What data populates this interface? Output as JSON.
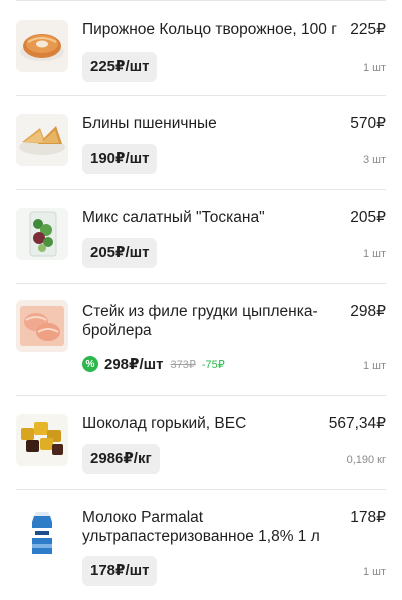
{
  "items": [
    {
      "name": "Пирожное Кольцо творожное, 100 г",
      "total": "225₽",
      "unit_price": "225₽/шт",
      "quantity": "1 шт"
    },
    {
      "name": "Блины пшеничные",
      "total": "570₽",
      "unit_price": "190₽/шт",
      "quantity": "3 шт"
    },
    {
      "name": "Микс салатный \"Тоскана\"",
      "total": "205₽",
      "unit_price": "205₽/шт",
      "quantity": "1 шт"
    },
    {
      "name": "Стейк из филе грудки цыпленка-бройлера",
      "total": "298₽",
      "unit_price": "298₽/шт",
      "old_price": "373₽",
      "discount": "-75₽",
      "discount_icon": "%",
      "quantity": "1 шт"
    },
    {
      "name": "Шоколад горький, ВЕС",
      "total": "567,34₽",
      "unit_price": "2986₽/кг",
      "quantity": "0,190 кг"
    },
    {
      "name": "Молоко Parmalat ультрапастеризованное 1,8% 1 л",
      "total": "178₽",
      "unit_price": "178₽/шт",
      "quantity": "1 шт"
    }
  ],
  "colors": {
    "discount_green": "#2db84d",
    "chip_bg": "#eeeeee",
    "divider": "#e6e6e6"
  }
}
